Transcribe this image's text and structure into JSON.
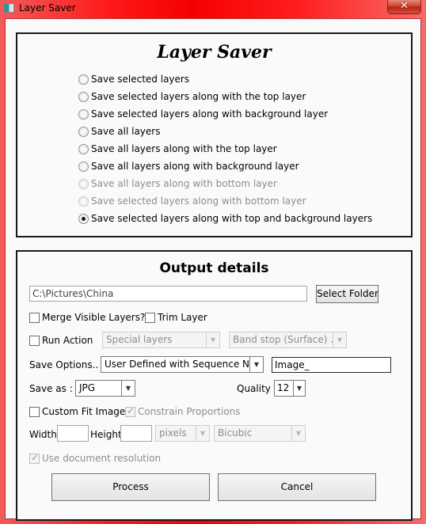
{
  "window": {
    "title": "Layer Saver",
    "close_glyph": "✕"
  },
  "top_panel": {
    "heading": "Layer Saver",
    "options": [
      {
        "label": "Save selected layers",
        "checked": false,
        "enabled": true
      },
      {
        "label": "Save selected layers along with the top layer",
        "checked": false,
        "enabled": true
      },
      {
        "label": "Save selected layers along with background layer",
        "checked": false,
        "enabled": true
      },
      {
        "label": "Save all layers",
        "checked": false,
        "enabled": true
      },
      {
        "label": "Save all layers along with the top layer",
        "checked": false,
        "enabled": true
      },
      {
        "label": "Save all layers along with background layer",
        "checked": false,
        "enabled": true
      },
      {
        "label": "Save all layers along with bottom layer",
        "checked": false,
        "enabled": false
      },
      {
        "label": "Save selected layers along with bottom layer",
        "checked": false,
        "enabled": false
      },
      {
        "label": "Save selected layers along with top and background layers",
        "checked": true,
        "enabled": true
      }
    ]
  },
  "output": {
    "heading": "Output details",
    "folder_path": "C:\\Pictures\\China",
    "select_folder_label": "Select Folder",
    "merge_visible_label": "Merge Visible Layers?",
    "trim_layer_label": "Trim Layer",
    "run_action_label": "Run Action",
    "action_set": "Special layers",
    "action_name": "Band stop (Surface) ...",
    "save_options_label": "Save Options..",
    "save_options_value": "User Defined with Sequence No.",
    "file_prefix": "Image_",
    "save_as_label": "Save as :",
    "save_as_value": "JPG",
    "quality_label": "Quality",
    "quality_value": "12",
    "custom_fit_label": "Custom Fit Image",
    "constrain_label": "Constrain Proportions",
    "width_label": "Width",
    "width_value": "",
    "height_label": "Height",
    "height_value": "",
    "units_value": "pixels",
    "resample_value": "Bicubic",
    "use_doc_res_label": "Use document resolution",
    "process_label": "Process",
    "cancel_label": "Cancel"
  },
  "icons": {
    "dropdown": "▼"
  }
}
